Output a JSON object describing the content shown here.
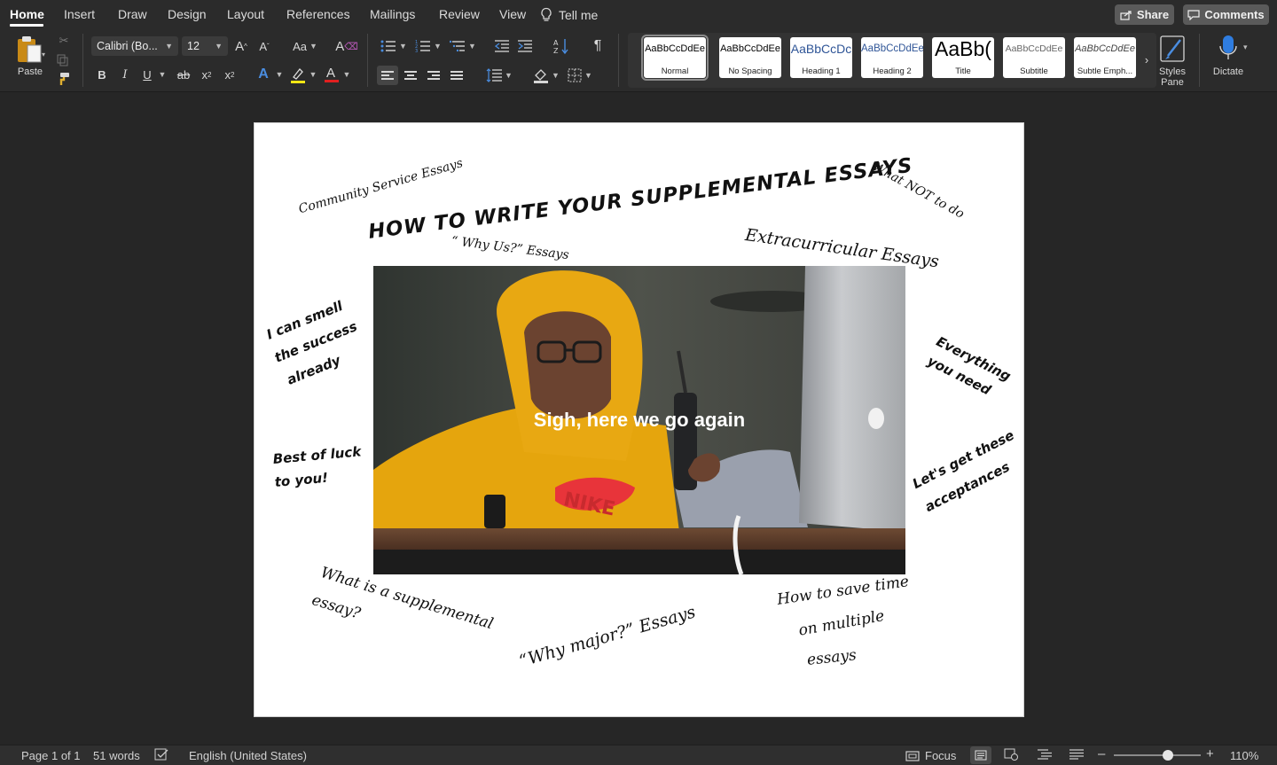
{
  "tabs": [
    {
      "label": "Home",
      "active": true
    },
    {
      "label": "Insert"
    },
    {
      "label": "Draw"
    },
    {
      "label": "Design"
    },
    {
      "label": "Layout"
    },
    {
      "label": "References"
    },
    {
      "label": "Mailings"
    },
    {
      "label": "Review"
    },
    {
      "label": "View"
    },
    {
      "label": "Tell me"
    }
  ],
  "top_buttons": {
    "share": "Share",
    "comments": "Comments"
  },
  "ribbon": {
    "paste_label": "Paste",
    "font_name": "Calibri (Bo...",
    "font_size": "12",
    "case_label": "Aa",
    "bold": "B",
    "italic": "I",
    "underline": "U",
    "strike": "ab",
    "subscript": "x",
    "superscript": "x",
    "font_color_letter": "A",
    "highlight_color": "#f5e614",
    "font_color": "#e02020",
    "pilcrow": "¶",
    "styles": [
      {
        "sample": "AaBbCcDdEe",
        "name": "Normal",
        "selected": true
      },
      {
        "sample": "AaBbCcDdEe",
        "name": "No Spacing"
      },
      {
        "sample": "AaBbCcDc",
        "name": "Heading 1"
      },
      {
        "sample": "AaBbCcDdEe",
        "name": "Heading 2"
      },
      {
        "sample": "AaBb(",
        "name": "Title"
      },
      {
        "sample": "AaBbCcDdEe",
        "name": "Subtitle"
      },
      {
        "sample": "AaBbCcDdEe",
        "name": "Subtle Emph..."
      }
    ],
    "styles_pane_label_1": "Styles",
    "styles_pane_label_2": "Pane",
    "dictate_label": "Dictate"
  },
  "document": {
    "title": "HOW TO WRITE YOUR SUPPLEMENTAL ESSAYS",
    "photo_caption": "Sigh, here we go again",
    "notes": {
      "community": "Community Service Essays",
      "what_not": "What NOT to do",
      "why_us": "“ Why Us?” Essays",
      "extracurricular": "Extracurricular Essays",
      "smell_1": "I can smell",
      "smell_2": "the success",
      "smell_3": "already",
      "everything_1": "Everything",
      "everything_2": "you need",
      "luck_1": "Best of luck",
      "luck_2": "to you!",
      "accept_1": "Let's get these",
      "accept_2": "acceptances",
      "whatis_1": "What is a supplemental",
      "whatis_2": "essay?",
      "why_major": "“Why major?” Essays",
      "save_1": "How to save time",
      "save_2": "on multiple",
      "save_3": "essays"
    }
  },
  "status": {
    "page": "Page 1 of 1",
    "words": "51 words",
    "language": "English (United States)",
    "focus": "Focus",
    "zoom": "110%",
    "zoom_level": 0.62
  },
  "colors": {
    "accent_yellow": "#e8a812",
    "nike_red": "#e8343a"
  }
}
